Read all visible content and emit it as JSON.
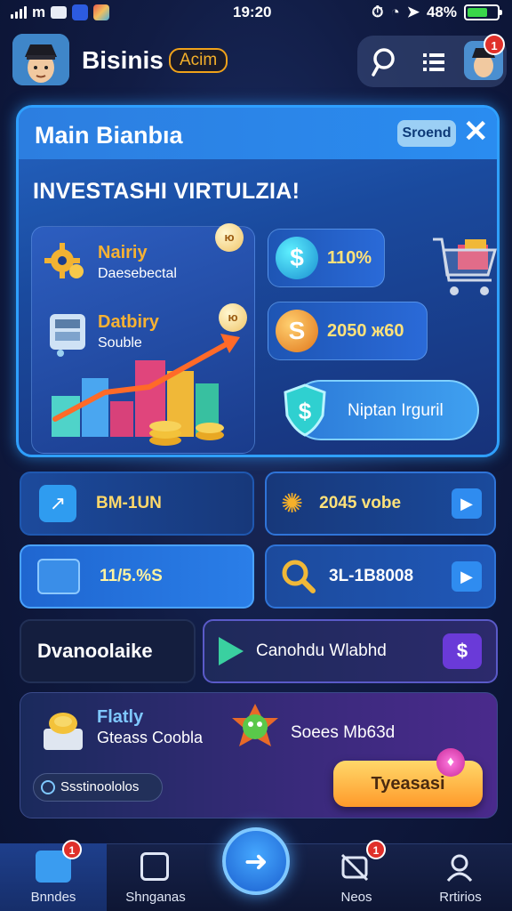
{
  "status_bar": {
    "carrier": "m",
    "time": "19:20",
    "battery_text": "48%"
  },
  "header": {
    "title": "Bisinis",
    "badge": "Acim"
  },
  "main_panel": {
    "title": "Main Bianbıa",
    "chip": "Sroend",
    "heading": "INVESTASHI VIRTULZIA!",
    "card": {
      "item1_title": "Nairiy",
      "item1_sub": "Daesebectal",
      "item2_title": "Datbiry",
      "item2_sub": "Souble",
      "coin1": "ю",
      "coin2": "ю"
    },
    "stat1": "110%",
    "stat2": "2050 ж60",
    "shield_label": "Niptan Irguril"
  },
  "tiles": {
    "t1": "BM-1UN",
    "t2": "2045 vobe",
    "t3": "11/5.%S",
    "t4": "3L-1B8008",
    "t5": "Dvanoolaike",
    "t6": "Canohdu Wlabhd"
  },
  "promo": {
    "title": "Flatly",
    "sub": "Gteass Coobla",
    "right_text": "Soees Mb63d",
    "pill": "Ssstinoololos",
    "cta": "Tyeasasi"
  },
  "nav": {
    "item1": "Bnndes",
    "item1_badge": "1",
    "item2": "Shnganas",
    "item3": "Neos",
    "item3_badge": "1",
    "item4": "Rrtirios"
  },
  "notif_count": "1",
  "colors": {
    "accent": "#2fa0ff",
    "gold": "#f5b02a",
    "cta": "#ffb43a",
    "alert": "#e0302a"
  }
}
